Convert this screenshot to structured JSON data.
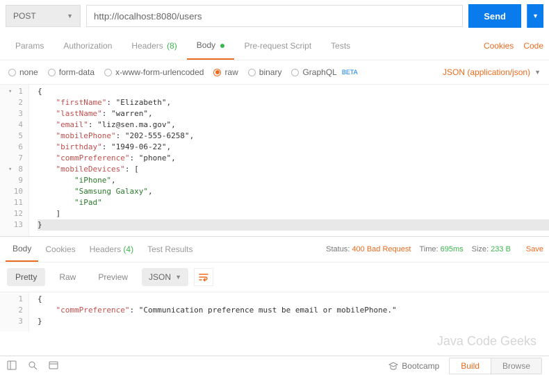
{
  "request": {
    "method": "POST",
    "url": "http://localhost:8080/users",
    "send_label": "Send"
  },
  "tabs": {
    "params": "Params",
    "authorization": "Authorization",
    "headers": "Headers",
    "headers_count": "(8)",
    "body": "Body",
    "prerequest": "Pre-request Script",
    "tests": "Tests",
    "cookies_link": "Cookies",
    "code_link": "Code"
  },
  "body_types": {
    "none": "none",
    "form_data": "form-data",
    "urlencoded": "x-www-form-urlencoded",
    "raw": "raw",
    "binary": "binary",
    "graphql": "GraphQL",
    "beta": "BETA",
    "content_type": "JSON (application/json)"
  },
  "request_body": {
    "lines": [
      "{",
      "    \"firstName\": \"Elizabeth\",",
      "    \"lastName\": \"warren\",",
      "    \"email\": \"liz@sen.ma.gov\",",
      "    \"mobilePhone\": \"202-555-6258\",",
      "    \"birthday\": \"1949-06-22\",",
      "    \"commPreference\": \"phone\",",
      "    \"mobileDevices\": [",
      "        \"iPhone\",",
      "        \"Samsung Galaxy\",",
      "        \"iPad\"",
      "    ]",
      "}"
    ]
  },
  "response_tabs": {
    "body": "Body",
    "cookies": "Cookies",
    "headers": "Headers",
    "headers_count": "(4)",
    "test_results": "Test Results"
  },
  "response_meta": {
    "status_label": "Status:",
    "status_value": "400 Bad Request",
    "time_label": "Time:",
    "time_value": "695ms",
    "size_label": "Size:",
    "size_value": "233 B",
    "save": "Save"
  },
  "view_bar": {
    "pretty": "Pretty",
    "raw": "Raw",
    "preview": "Preview",
    "format": "JSON"
  },
  "response_body": {
    "lines": [
      "{",
      "    \"commPreference\": \"Communication preference must be email or mobilePhone.\"",
      "}"
    ]
  },
  "bottom": {
    "bootcamp": "Bootcamp",
    "build": "Build",
    "browse": "Browse"
  }
}
